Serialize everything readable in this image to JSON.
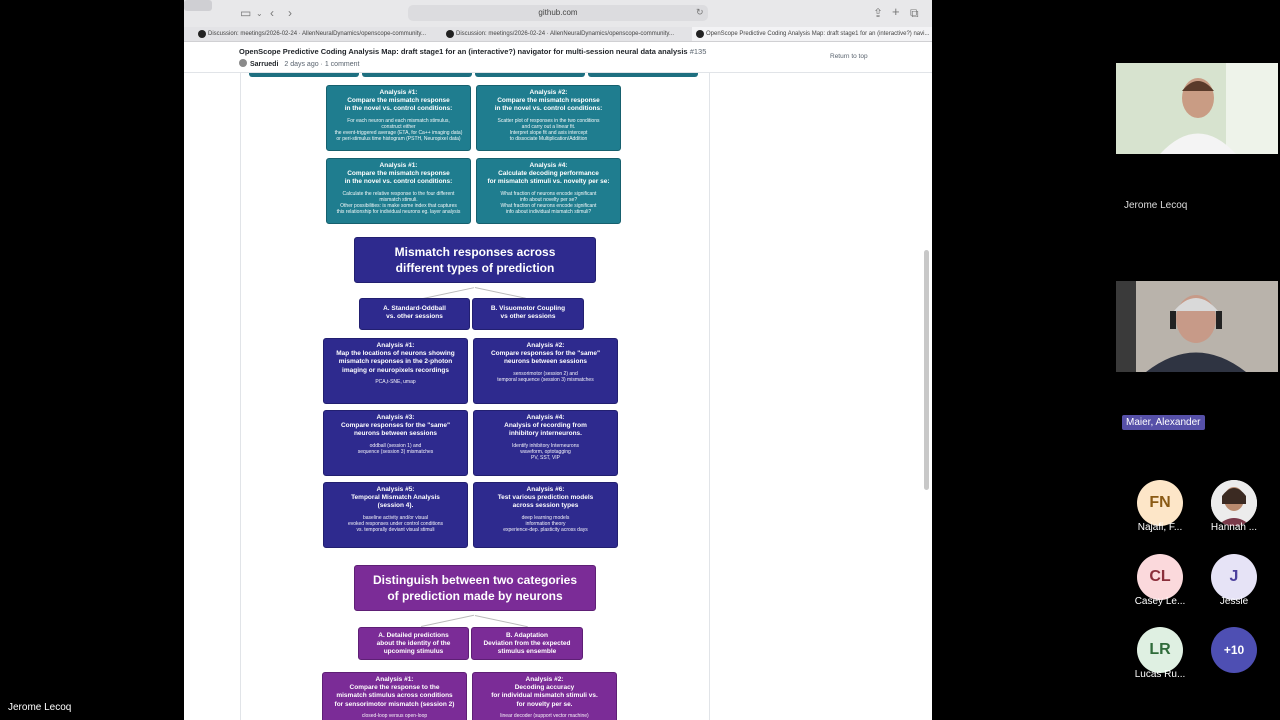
{
  "browser": {
    "url": "github.com",
    "tabs": [
      {
        "label": "Discussion: meetings/2026-02-24 · AllenNeuralDynamics/openscope-community..."
      },
      {
        "label": "Discussion: meetings/2026-02-24 · AllenNeuralDynamics/openscope-community..."
      },
      {
        "label": "OpenScope Predictive Coding Analysis Map: draft stage1 for an (interactive?) navi..."
      }
    ]
  },
  "discussion": {
    "title": "OpenScope Predictive Coding Analysis Map: draft stage1 for an (interactive?) navigator for multi-session neural data analysis",
    "number": "#135",
    "author": "Sarruedi",
    "time": "2 days ago",
    "comments": "1 comment",
    "return_to_top": "Return to top"
  },
  "flowchart": {
    "teal": [
      {
        "title": "Analysis #1:\nCompare the mismatch response\nin the novel vs. control conditions:",
        "body": "For each neuron and each mismatch stimulus,\nconstruct either\nthe event-triggered average (ETA, for Ca++ imaging data)\nor peri-stimulus time histogram (PSTH, Neuropixel data)"
      },
      {
        "title": "Analysis #2:\nCompare the mismatch response\nin the novel vs. control conditions:",
        "body": "Scatter plot of responses in the two conditions\nand carry out a linear fit.\nInterpret slope fit and axis intercept\nto dissociate Multiplication/Addition"
      },
      {
        "title": "Analysis #1:\nCompare the mismatch response\nin the novel vs. control conditions:",
        "body": "Calculate the relative response to the four different\nmismatch stimuli.\nOther possibilities: is make some index that captures\nthis relationship for individual neurons eg. layer analysis"
      },
      {
        "title": "Analysis #4:\nCalculate decoding performance\nfor mismatch stimuli vs. novelty per se:",
        "body": "What fraction of neurons encode significant\ninfo about novelty per se?\nWhat fraction of neurons encode significant\ninfo about individual mismatch stimuli?"
      }
    ],
    "mismatch_title": "Mismatch responses across\ndifferent types of prediction",
    "mismatch_subs": [
      {
        "title": "A. Standard-Oddball\nvs. other sessions"
      },
      {
        "title": "B. Visuomotor Coupling\nvs other sessions"
      }
    ],
    "indigo": [
      {
        "title": "Analysis #1:\nMap the locations of neurons showing\nmismatch responses in the 2-photon\nimaging or neuropixels recordings",
        "body": "PCA,t-SNE, umap"
      },
      {
        "title": "Analysis #2:\nCompare responses for the \"same\"\nneurons between sessions",
        "body": "sensorimotor (session 2) and\ntemporal sequence (session 3) mismatches"
      },
      {
        "title": "Analysis #3:\nCompare responses for the \"same\"\nneurons between sessions",
        "body": "oddball (session 1) and\nsequence (session 3) mismatches"
      },
      {
        "title": "Analysis #4:\nAnalysis of recording from\ninhibitory interneurons.",
        "body": "Identify inhibitory Interneurons\nwaveform, optotagging\nPV, SST, VIP"
      },
      {
        "title": "Analysis #5:\nTemporal Mismatch Analysis\n(session 4).",
        "body": "baseline activity and/or visual\nevoked responses under control conditions\nvs. temporally deviant visual stimuli"
      },
      {
        "title": "Analysis #6:\nTest various prediction models\nacross session types",
        "body": "deep learning models\ninformation theory\nexperience-dep. plasticity across days"
      }
    ],
    "distinguish_title": "Distinguish between two categories\nof prediction made by neurons",
    "distinguish_subs": [
      {
        "title": "A. Detailed predictions\nabout the identity of the\nupcoming stimulus"
      },
      {
        "title": "B. Adaptation\nDeviation from the expected\nstimulus ensemble"
      }
    ],
    "purple": [
      {
        "title": "Analysis #1:\nCompare the response to the\nmismatch stimulus across conditions\nfor sensorimotor mismatch (session 2)",
        "body": "closed-loop versus open-loop"
      },
      {
        "title": "Analysis #2:\nDecoding accuracy\nfor individual mismatch stimuli vs.\nfor novelty per se.",
        "body": "linear decoder (support vector machine)"
      }
    ]
  },
  "meeting": {
    "participant_top": "Jerome Lecoq",
    "participant_mid": "Maier, Alexander",
    "self_name": "Jerome Lecoq",
    "avatars": [
      {
        "initials": "FN",
        "label": "Najafi, F...",
        "bg": "#fde6c8",
        "fg": "#8a5a14"
      },
      {
        "initials": "",
        "label": "Hannah ...",
        "bg": "#f2f2f2",
        "fg": "#333"
      },
      {
        "initials": "CL",
        "label": "Casey Le...",
        "bg": "#fbd9dc",
        "fg": "#8a2f3b"
      },
      {
        "initials": "J",
        "label": "Jessie",
        "bg": "#e6e3f6",
        "fg": "#4b3f9c"
      },
      {
        "initials": "LR",
        "label": "Lucas Ru...",
        "bg": "#dff0e2",
        "fg": "#2f6b3a"
      },
      {
        "initials": "+10",
        "label": "",
        "bg": "#4e4fb3",
        "fg": "#ffffff"
      }
    ]
  }
}
